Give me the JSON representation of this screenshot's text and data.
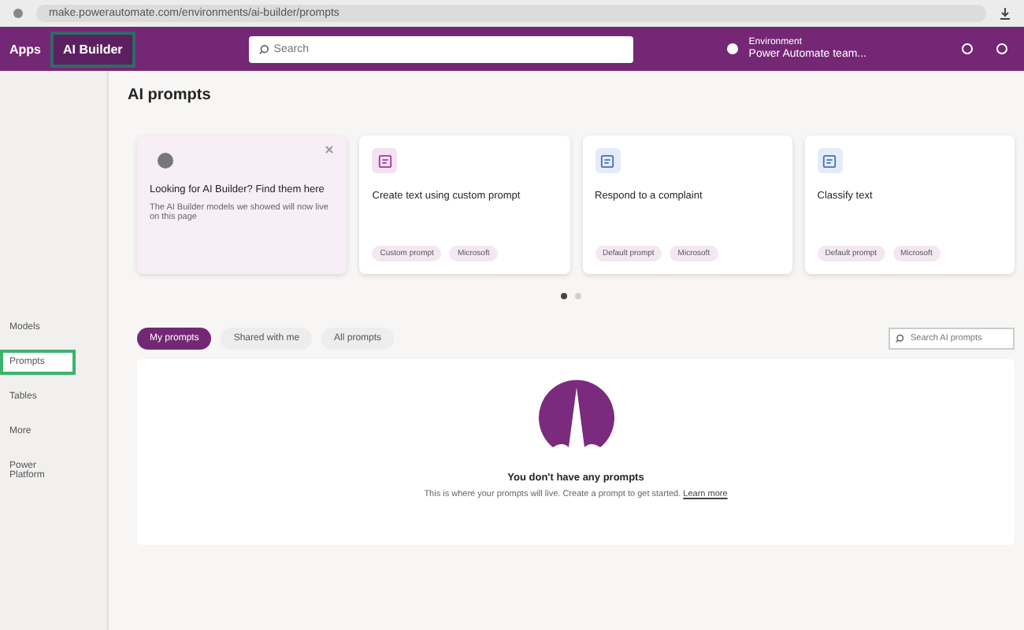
{
  "browser": {
    "url": "make.powerautomate.com/environments/ai-builder/prompts"
  },
  "header": {
    "app": "Apps",
    "product": "AI Builder",
    "search_placeholder": "Search",
    "environment_label": "Environment",
    "environment": "Power Automate team..."
  },
  "sidebar": {
    "items": [
      {
        "label": "Models",
        "selected": false
      },
      {
        "label": "Prompts",
        "selected": true
      },
      {
        "label": "Tables",
        "selected": false
      },
      {
        "label": "More",
        "selected": false
      },
      {
        "label": "Power Platform",
        "selected": false
      }
    ]
  },
  "page_title": "AI prompts",
  "cards": [
    {
      "kind": "info",
      "title": "Looking for AI Builder? Find them here",
      "description": "The AI Builder models we showed will now live on this page"
    },
    {
      "kind": "prompt",
      "title": "Create text using custom prompt",
      "tags": [
        "Custom prompt",
        "Microsoft"
      ]
    },
    {
      "kind": "prompt",
      "title": "Respond to a complaint",
      "tags": [
        "Default prompt",
        "Microsoft"
      ]
    },
    {
      "kind": "prompt",
      "title": "Classify text",
      "tags": [
        "Default prompt",
        "Microsoft"
      ]
    }
  ],
  "pager": [
    {
      "selected": true
    },
    {
      "selected": false
    }
  ],
  "tabs": [
    {
      "label": "My prompts",
      "selected": true
    },
    {
      "label": "Shared with me",
      "selected": false
    },
    {
      "label": "All prompts",
      "selected": false
    }
  ],
  "prompt_search": {
    "placeholder": "Search AI prompts"
  },
  "empty_state": {
    "title": "You don't have any prompts",
    "message": "This is where your prompts will live. Create a prompt to get started.",
    "link": "Learn more"
  }
}
